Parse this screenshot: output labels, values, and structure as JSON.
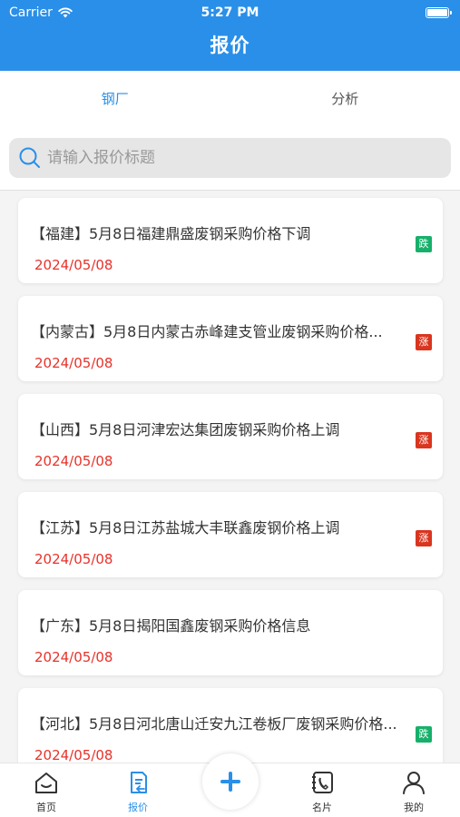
{
  "status_bar": {
    "carrier": "Carrier",
    "time": "5:27 PM"
  },
  "nav": {
    "title": "报价"
  },
  "tabs": [
    {
      "label": "钢厂",
      "active": true
    },
    {
      "label": "分析",
      "active": false
    }
  ],
  "search": {
    "placeholder": "请输入报价标题",
    "value": ""
  },
  "quotes": [
    {
      "title": "【福建】5月8日福建鼎盛废钢采购价格下调",
      "date": "2024/05/08",
      "badge": "跌"
    },
    {
      "title": "【内蒙古】5月8日内蒙古赤峰建支管业废钢采购价格...",
      "date": "2024/05/08",
      "badge": "涨"
    },
    {
      "title": "【山西】5月8日河津宏达集团废钢采购价格上调",
      "date": "2024/05/08",
      "badge": "涨"
    },
    {
      "title": "【江苏】5月8日江苏盐城大丰联鑫废钢价格上调",
      "date": "2024/05/08",
      "badge": "涨"
    },
    {
      "title": "【广东】5月8日揭阳国鑫废钢采购价格信息",
      "date": "2024/05/08",
      "badge": ""
    },
    {
      "title": "【河北】5月8日河北唐山迁安九江卷板厂废钢采购价格...",
      "date": "2024/05/08",
      "badge": "跌"
    }
  ],
  "tabbar": [
    {
      "label": "首页",
      "icon": "home-icon",
      "active": false
    },
    {
      "label": "报价",
      "icon": "quote-doc-icon",
      "active": true
    },
    {
      "label": "名片",
      "icon": "business-card-phone-icon",
      "active": false
    },
    {
      "label": "我的",
      "icon": "user-icon",
      "active": false
    }
  ],
  "colors": {
    "primary": "#2a8fe8",
    "date_red": "#e8322a",
    "badge_up": "#d9351f",
    "badge_down": "#16b06b"
  }
}
